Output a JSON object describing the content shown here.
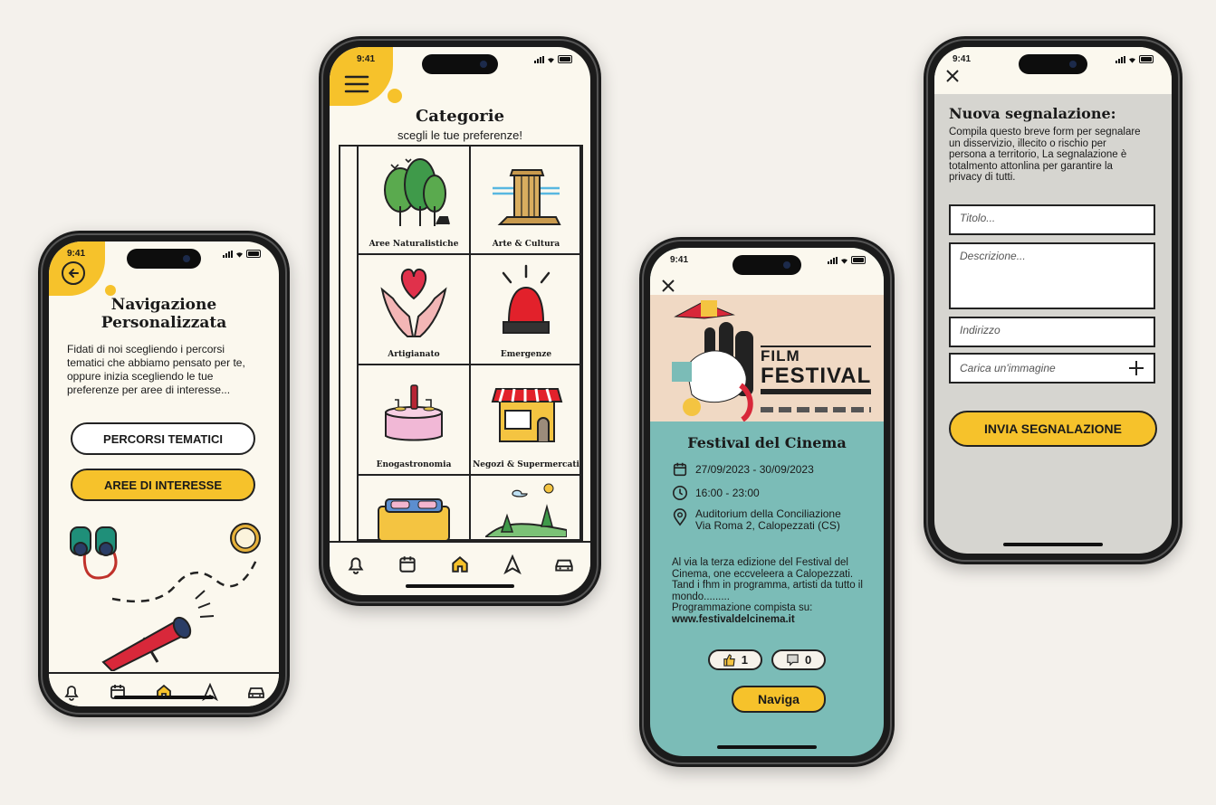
{
  "colors": {
    "accent": "#f6c22b",
    "teal": "#7bbcb7",
    "screen_bg": "#fbf8ee",
    "form_bg": "#d6d5d0",
    "page_bg": "#f4f1ec"
  },
  "status": {
    "time": "9:41"
  },
  "tabbar": {
    "icons": [
      "bell-icon",
      "calendar-icon",
      "home-icon",
      "navigation-arrow-icon",
      "car-icon"
    ]
  },
  "nav_screen": {
    "title_line1": "Navigazione",
    "title_line2": "Personalizzata",
    "body": "Fidati di noi scegliendo i percorsi tematici che abbiamo pensato per te, oppure inizia scegliendo le tue preferenze per aree di interesse...",
    "btn_percorsi": "PERCORSI TEMATICI",
    "btn_aree": "AREE DI INTERESSE"
  },
  "categories_screen": {
    "title": "Categorie",
    "subtitle": "scegli le tue preferenze!",
    "items": [
      {
        "label": "Aree Naturalistiche",
        "icon": "trees-icon"
      },
      {
        "label": "Arte & Cultura",
        "icon": "column-ruin-icon"
      },
      {
        "label": "Artigianato",
        "icon": "hands-heart-icon"
      },
      {
        "label": "Emergenze",
        "icon": "siren-icon"
      },
      {
        "label": "Enogastronomia",
        "icon": "dinner-table-icon"
      },
      {
        "label": "Negozi & Supermercati",
        "icon": "shop-icon"
      },
      {
        "label": "",
        "icon": "bed-icon"
      },
      {
        "label": "",
        "icon": "landscape-icon"
      }
    ]
  },
  "event_screen": {
    "poster_word1": "FILM",
    "poster_word2": "FESTIVAL",
    "title": "Festival del Cinema",
    "dates": "27/09/2023 - 30/09/2023",
    "hours": "16:00 - 23:00",
    "venue": "Auditorium della Conciliazione",
    "address": "Via Roma 2, Calopezzati (CS)",
    "description": "Al via la terza edizione del Festival del Cinema, one eccveleera a Calopezzati. Tand i fhm in programma, artisti da tutto il mondo.........",
    "program_label": "Programmazione compista su:",
    "website": "www.festivaldelcinema.it",
    "likes": "1",
    "dislikes": "0",
    "navigate_btn": "Naviga"
  },
  "report_screen": {
    "title": "Nuova segnalazione:",
    "intro": "Compila questo breve form per segnalare un disservizio, illecito o rischio per persona a territorio, La segnalazione è totalmento attonlina per garantire la privacy di tutti.",
    "title_placeholder": "Titolo...",
    "description_placeholder": "Descrizione...",
    "address_placeholder": "Indirizzo",
    "image_placeholder": "Carica un'immagine",
    "submit": "INVIA SEGNALAZIONE"
  }
}
